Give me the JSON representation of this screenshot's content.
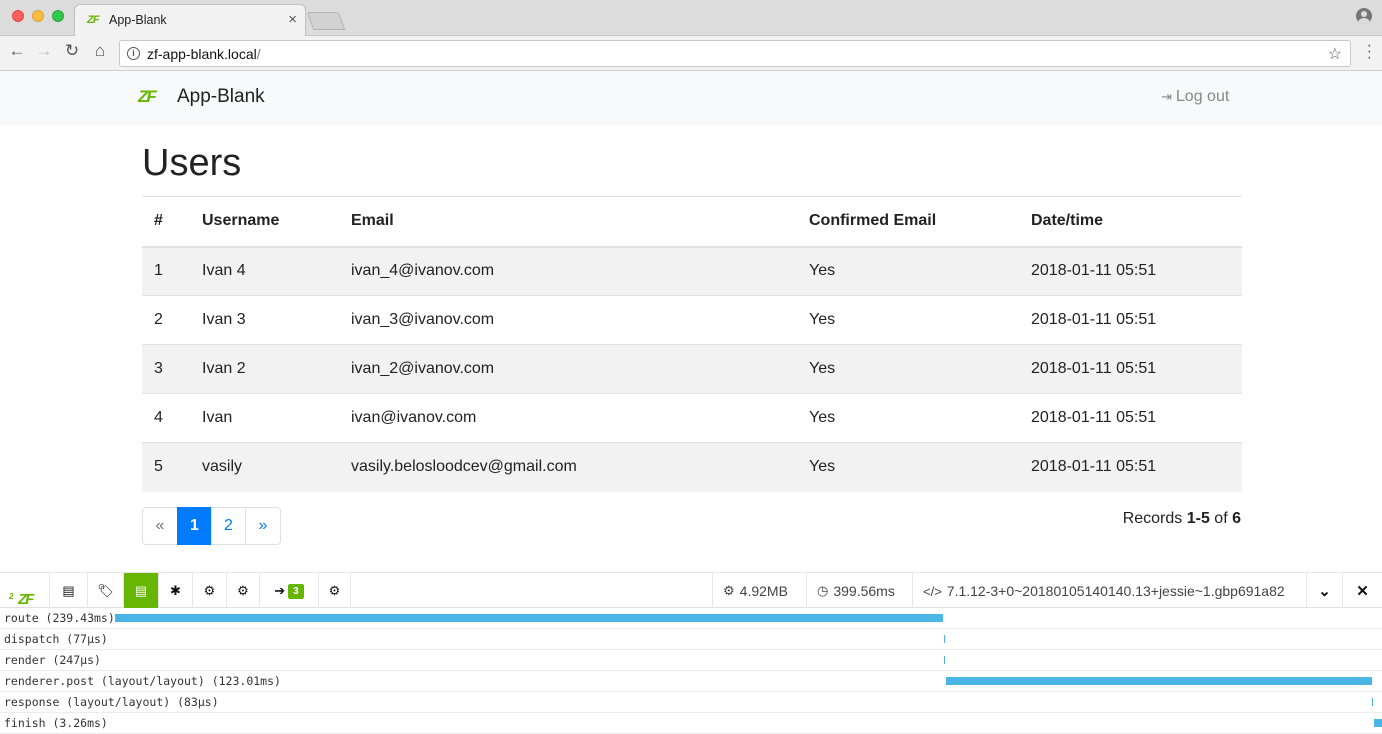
{
  "browser": {
    "tab_title": "App-Blank",
    "tab_favicon": "ZF",
    "tab_close": "×",
    "url_host": "zf-app-blank.local",
    "url_path": "/"
  },
  "app": {
    "brand_logo": "ZF",
    "brand_name": "App-Blank",
    "logout_label": "Log out"
  },
  "page": {
    "title": "Users",
    "columns": [
      "#",
      "Username",
      "Email",
      "Confirmed Email",
      "Date/time"
    ],
    "rows": [
      {
        "id": "1",
        "username": "Ivan 4",
        "email": "ivan_4@ivanov.com",
        "confirmed": "Yes",
        "datetime": "2018-01-11 05:51"
      },
      {
        "id": "2",
        "username": "Ivan 3",
        "email": "ivan_3@ivanov.com",
        "confirmed": "Yes",
        "datetime": "2018-01-11 05:51"
      },
      {
        "id": "3",
        "username": "Ivan 2",
        "email": "ivan_2@ivanov.com",
        "confirmed": "Yes",
        "datetime": "2018-01-11 05:51"
      },
      {
        "id": "4",
        "username": "Ivan",
        "email": "ivan@ivanov.com",
        "confirmed": "Yes",
        "datetime": "2018-01-11 05:51"
      },
      {
        "id": "5",
        "username": "vasily",
        "email": "vasily.belosloodcev@gmail.com",
        "confirmed": "Yes",
        "datetime": "2018-01-11 05:51"
      }
    ],
    "pagination": {
      "prev": "«",
      "pages": [
        "1",
        "2"
      ],
      "active_page": "1",
      "next": "»"
    },
    "records": {
      "prefix": "Records",
      "range": "1-5",
      "of": "of",
      "total": "6"
    }
  },
  "devtoolbar": {
    "logo": "ZF",
    "logo_version": "2",
    "badge_count": "3",
    "memory": "4.92MB",
    "time": "399.56ms",
    "php_version": "7.1.12-3+0~20180105140140.13+jessie~1.gbp691a82"
  },
  "timeline": [
    {
      "label": "route (239.43ms)"
    },
    {
      "label": "dispatch (77μs)"
    },
    {
      "label": "render (247μs)"
    },
    {
      "label": "renderer.post (layout/layout) (123.01ms)"
    },
    {
      "label": "response (layout/layout) (83μs)"
    },
    {
      "label": "finish (3.26ms)"
    }
  ],
  "colors": {
    "brand_green": "#68b604",
    "link_blue": "#007bff",
    "timeline_bar": "#4bb5e6"
  }
}
